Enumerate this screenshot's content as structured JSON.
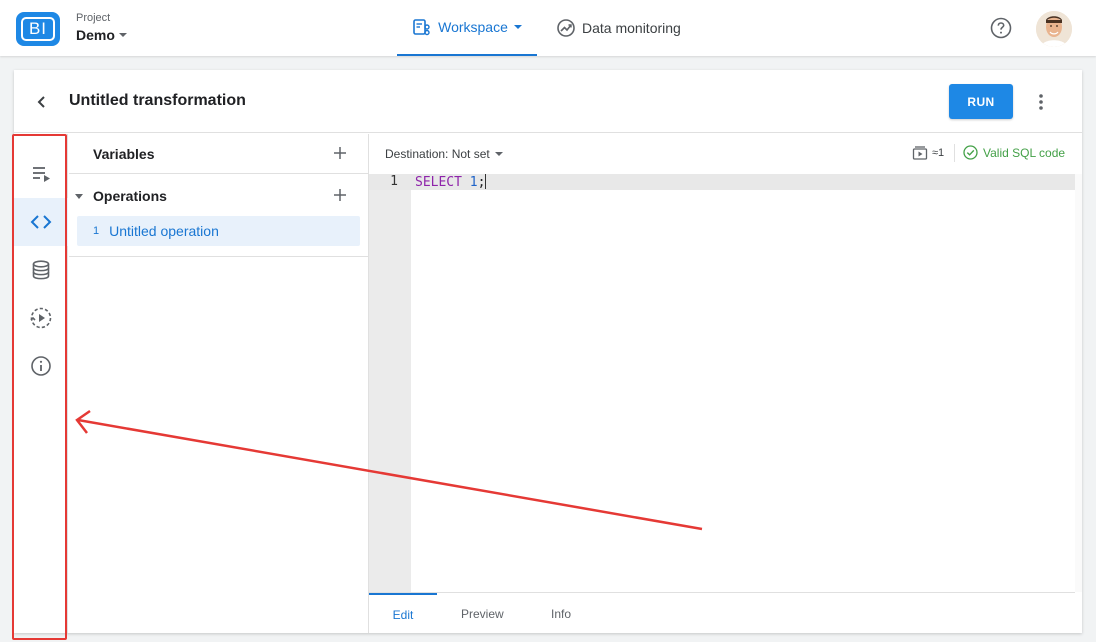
{
  "header": {
    "logo_text": "BI",
    "project_label": "Project",
    "project_name": "Demo",
    "nav": {
      "workspace": "Workspace",
      "monitoring": "Data monitoring"
    }
  },
  "card": {
    "title": "Untitled transformation",
    "run_label": "RUN"
  },
  "rail": {
    "items": [
      {
        "icon": "playlist-icon"
      },
      {
        "icon": "code-icon",
        "active": true
      },
      {
        "icon": "database-icon"
      },
      {
        "icon": "schedule-run-icon"
      },
      {
        "icon": "info-icon"
      }
    ]
  },
  "panel": {
    "variables_label": "Variables",
    "operations_label": "Operations",
    "operations": [
      {
        "number": "1",
        "name": "Untitled operation"
      }
    ]
  },
  "editor": {
    "destination": "Destination: Not set",
    "queue_value": "≈1",
    "status": "Valid SQL code",
    "line_number": "1",
    "code_keyword": "SELECT",
    "code_number": "1",
    "code_end": ";",
    "tabs": [
      "Edit",
      "Preview",
      "Info"
    ]
  },
  "colors": {
    "accent": "#1e88e5",
    "valid": "#43a047",
    "annotation": "#e53935"
  }
}
